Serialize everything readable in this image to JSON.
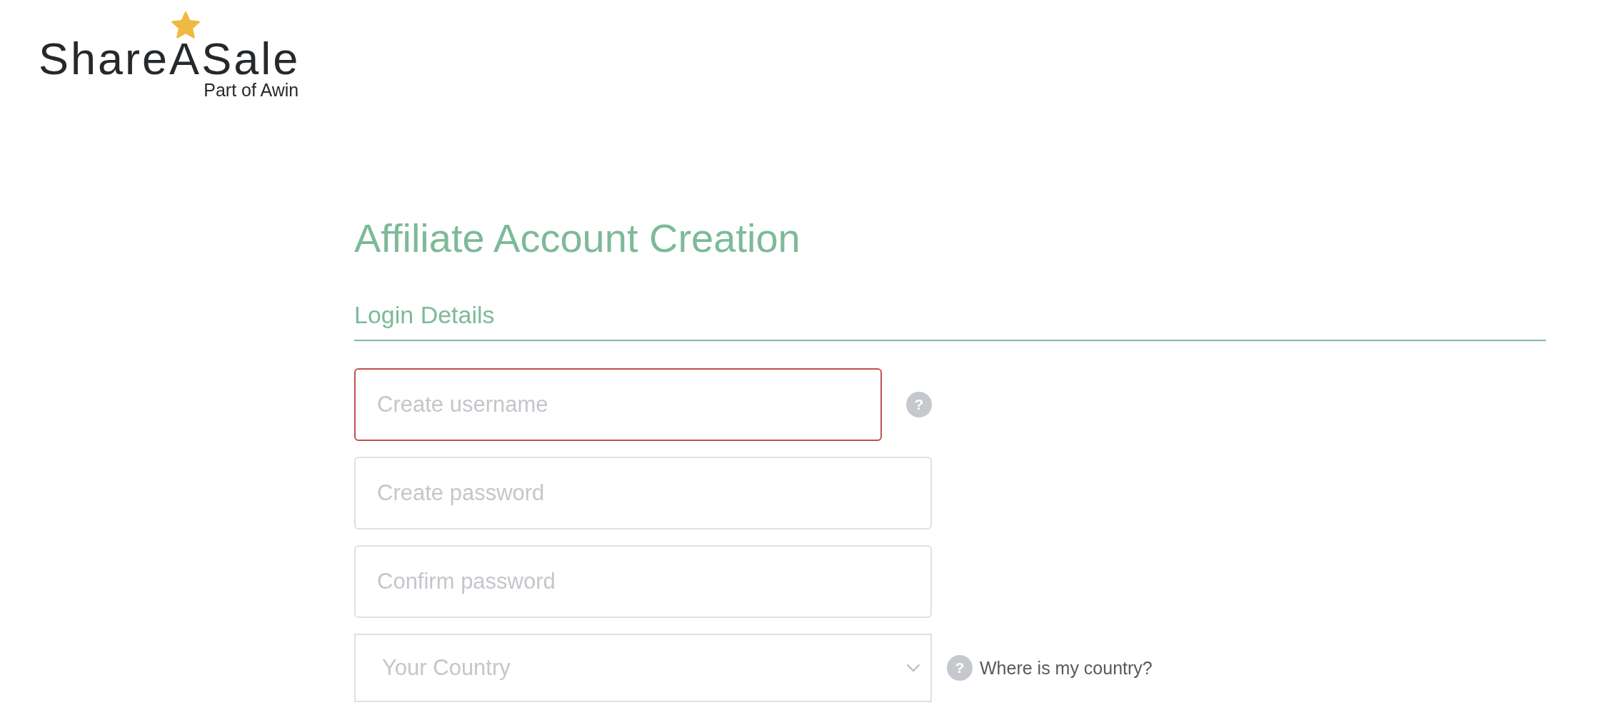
{
  "logo": {
    "name": "ShareASale",
    "tagline": "Part of Awin"
  },
  "title": "Affiliate Account Creation",
  "section": {
    "title": "Login Details"
  },
  "fields": [
    {
      "kind": "input",
      "placeholder": "Create username",
      "invalid": true,
      "help": "?"
    },
    {
      "kind": "input",
      "placeholder": "Create password",
      "invalid": false
    },
    {
      "kind": "input",
      "placeholder": "Confirm password",
      "invalid": false
    },
    {
      "kind": "select",
      "placeholder": "Your Country",
      "invalid": false,
      "help": "?",
      "help_text": "Where is my country?"
    }
  ]
}
